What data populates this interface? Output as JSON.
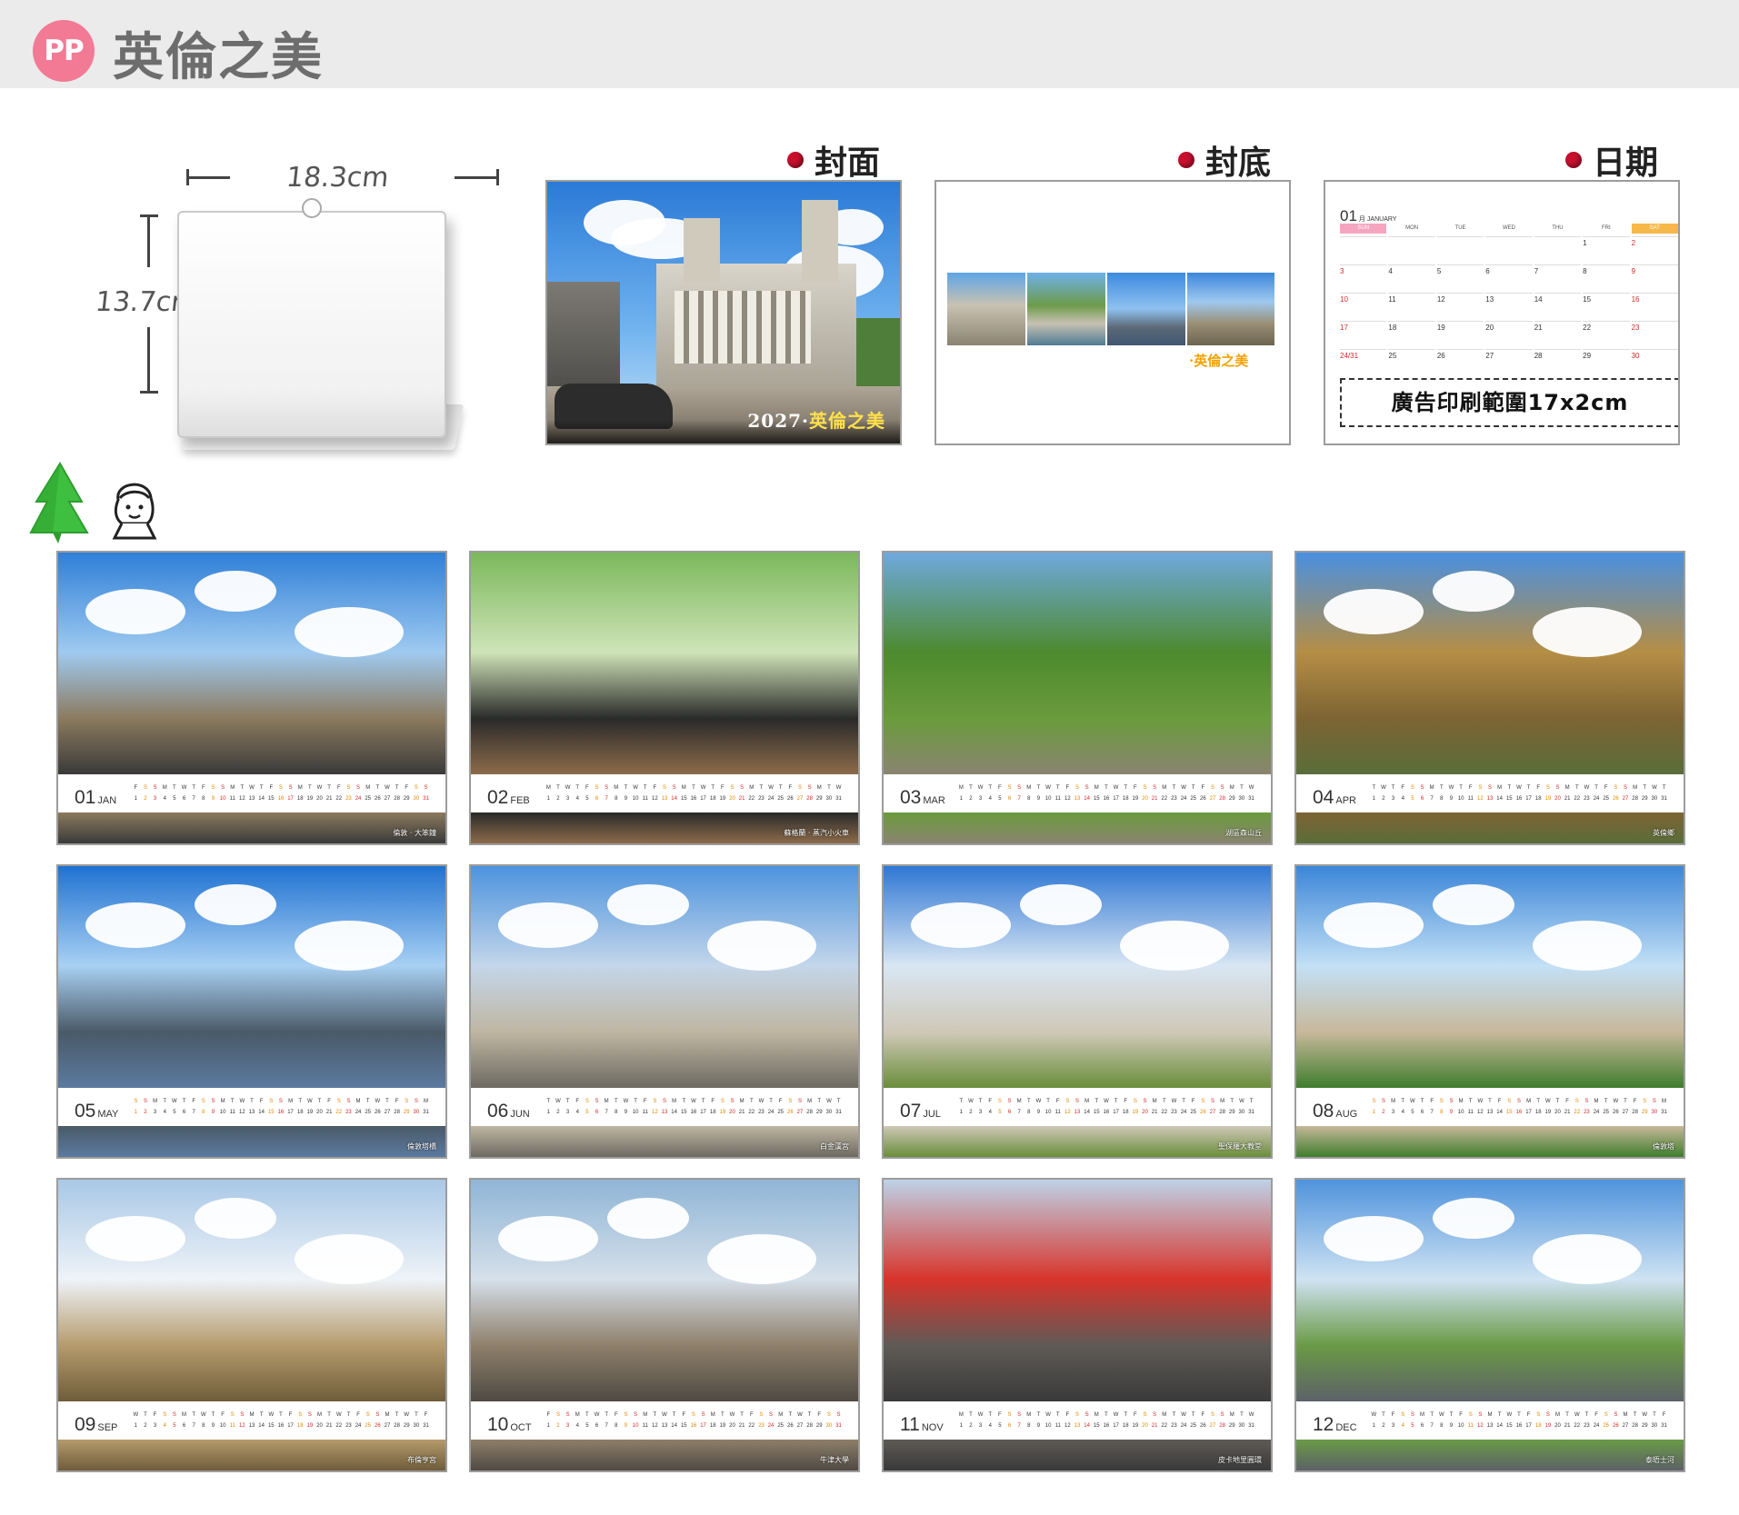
{
  "header": {
    "badge": "PP",
    "title": "英倫之美"
  },
  "size": {
    "width_label": "18.3cm",
    "height_label": "13.7cm"
  },
  "sections": {
    "cover": "封面",
    "back": "封底",
    "date": "日期"
  },
  "cover": {
    "title_year": "2027",
    "title_text": "英倫之美",
    "taxi_text": "TAXI"
  },
  "back": {
    "caption": "英倫之美"
  },
  "date_page": {
    "month_num": "01",
    "month_name": "JANUARY",
    "weekdays": [
      "SUN",
      "MON",
      "TUE",
      "WED",
      "THU",
      "FRI",
      "SAT"
    ],
    "weeks": [
      [
        "",
        "",
        "",
        "",
        "",
        "1",
        "2"
      ],
      [
        "3",
        "4",
        "5",
        "6",
        "7",
        "8",
        "9"
      ],
      [
        "10",
        "11",
        "12",
        "13",
        "14",
        "15",
        "16"
      ],
      [
        "17",
        "18",
        "19",
        "20",
        "21",
        "22",
        "23"
      ],
      [
        "24|31",
        "25",
        "26",
        "27",
        "28",
        "29",
        "30"
      ]
    ],
    "ad_text": "廣告印刷範圍17x2cm"
  },
  "months": [
    {
      "num": "01",
      "abbr": "JAN",
      "caption": "倫敦 · 大笨鐘",
      "first": "F"
    },
    {
      "num": "02",
      "abbr": "FEB",
      "caption": "蘇格蘭 · 蒸汽小火車",
      "first": "M"
    },
    {
      "num": "03",
      "abbr": "MAR",
      "caption": "湖區森山丘",
      "first": "M"
    },
    {
      "num": "04",
      "abbr": "APR",
      "caption": "英倫鄉",
      "first": "T"
    },
    {
      "num": "05",
      "abbr": "MAY",
      "caption": "倫敦塔橋",
      "first": "S"
    },
    {
      "num": "06",
      "abbr": "JUN",
      "caption": "白金漢宮",
      "first": "T"
    },
    {
      "num": "07",
      "abbr": "JUL",
      "caption": "聖保羅大教堂",
      "first": "T"
    },
    {
      "num": "08",
      "abbr": "AUG",
      "caption": "倫敦塔",
      "first": "S"
    },
    {
      "num": "09",
      "abbr": "SEP",
      "caption": "布倫亨宮",
      "first": "W"
    },
    {
      "num": "10",
      "abbr": "OCT",
      "caption": "牛津大學",
      "first": "F"
    },
    {
      "num": "11",
      "abbr": "NOV",
      "caption": "皮卡地里圓環",
      "first": "M"
    },
    {
      "num": "12",
      "abbr": "DEC",
      "caption": "泰晤士河",
      "first": "W"
    }
  ]
}
